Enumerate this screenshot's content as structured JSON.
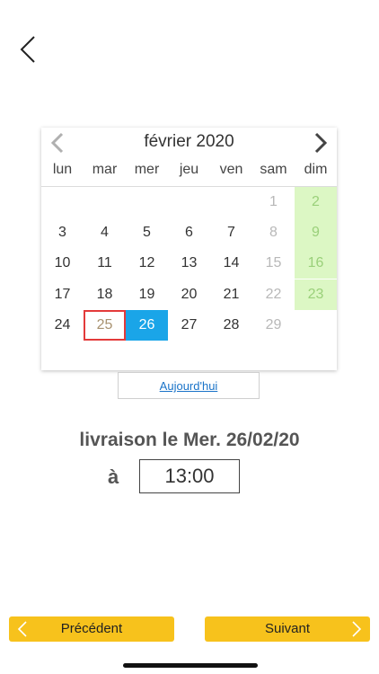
{
  "calendar": {
    "month_title": "février 2020",
    "weekdays": [
      "lun",
      "mar",
      "mer",
      "jeu",
      "ven",
      "sam",
      "dim"
    ],
    "weeks": [
      [
        "",
        "",
        "",
        "",
        "",
        "1",
        "2"
      ],
      [
        "3",
        "4",
        "5",
        "6",
        "7",
        "8",
        "9"
      ],
      [
        "10",
        "11",
        "12",
        "13",
        "14",
        "15",
        "16"
      ],
      [
        "17",
        "18",
        "19",
        "20",
        "21",
        "22",
        "23"
      ],
      [
        "24",
        "25",
        "26",
        "27",
        "28",
        "29",
        ""
      ]
    ],
    "today": "25",
    "selected": "26",
    "muted_days": [
      "1",
      "8",
      "15",
      "22",
      "29"
    ],
    "weekend_highlight_days": [
      "2",
      "9",
      "16",
      "23"
    ],
    "colors": {
      "selected_bg": "#1aa5e8",
      "weekend_bg": "#dcf7c4",
      "today_border": "#e33a3a"
    }
  },
  "today_button": {
    "label": "Aujourd'hui"
  },
  "delivery": {
    "label": "livraison le Mer. 26/02/20",
    "at_label": "à",
    "time": "13:00"
  },
  "footer": {
    "prev_label": "Précédent",
    "next_label": "Suivant",
    "button_color": "#f7c21c"
  },
  "icons": {
    "back": "chevron-left-icon",
    "prev_month": "chevron-left-icon",
    "next_month": "chevron-right-icon"
  }
}
